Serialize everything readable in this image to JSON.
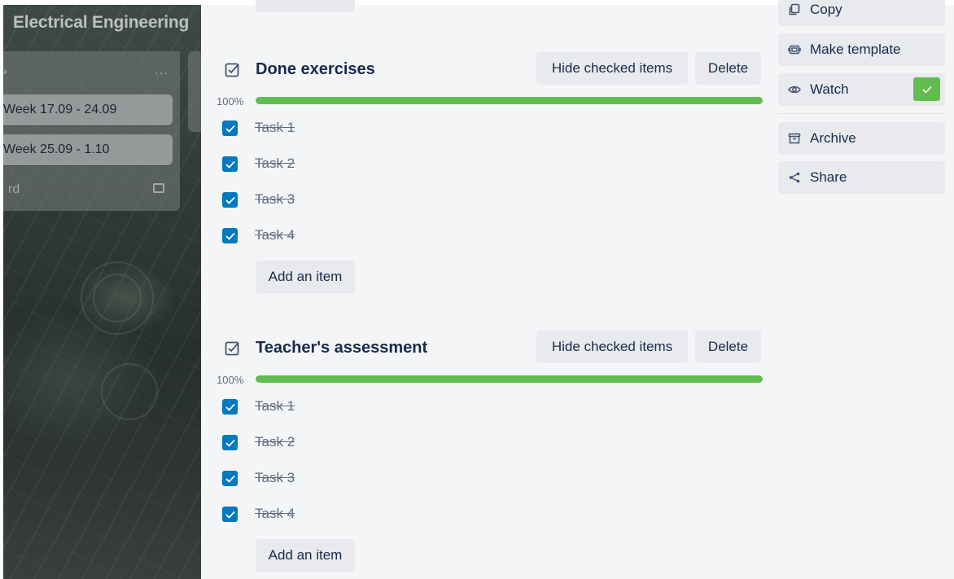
{
  "board": {
    "title": "Electrical Engineering",
    "list_menu": "···",
    "list_header_fragment": "›",
    "cards": [
      "Week 17.09 - 24.09",
      "Week 25.09 - 1.10"
    ],
    "add_card_fragment": "rd"
  },
  "checklists": [
    {
      "title": "Done exercises",
      "hide_label": "Hide checked items",
      "delete_label": "Delete",
      "progress_text": "100%",
      "progress_value": 100,
      "items": [
        "Task 1",
        "Task 2",
        "Task 3",
        "Task 4"
      ],
      "add_label": "Add an item"
    },
    {
      "title": "Teacher's assessment",
      "hide_label": "Hide checked items",
      "delete_label": "Delete",
      "progress_text": "100%",
      "progress_value": 100,
      "items": [
        "Task 1",
        "Task 2",
        "Task 3",
        "Task 4"
      ],
      "add_label": "Add an item"
    }
  ],
  "sidebar": {
    "copy": "Copy",
    "make_template": "Make template",
    "watch": "Watch",
    "watching": true,
    "archive": "Archive",
    "share": "Share"
  },
  "colors": {
    "progress_complete": "#61bd4f",
    "checkbox_checked": "#0079bf",
    "watch_active": "#61bd4f"
  }
}
